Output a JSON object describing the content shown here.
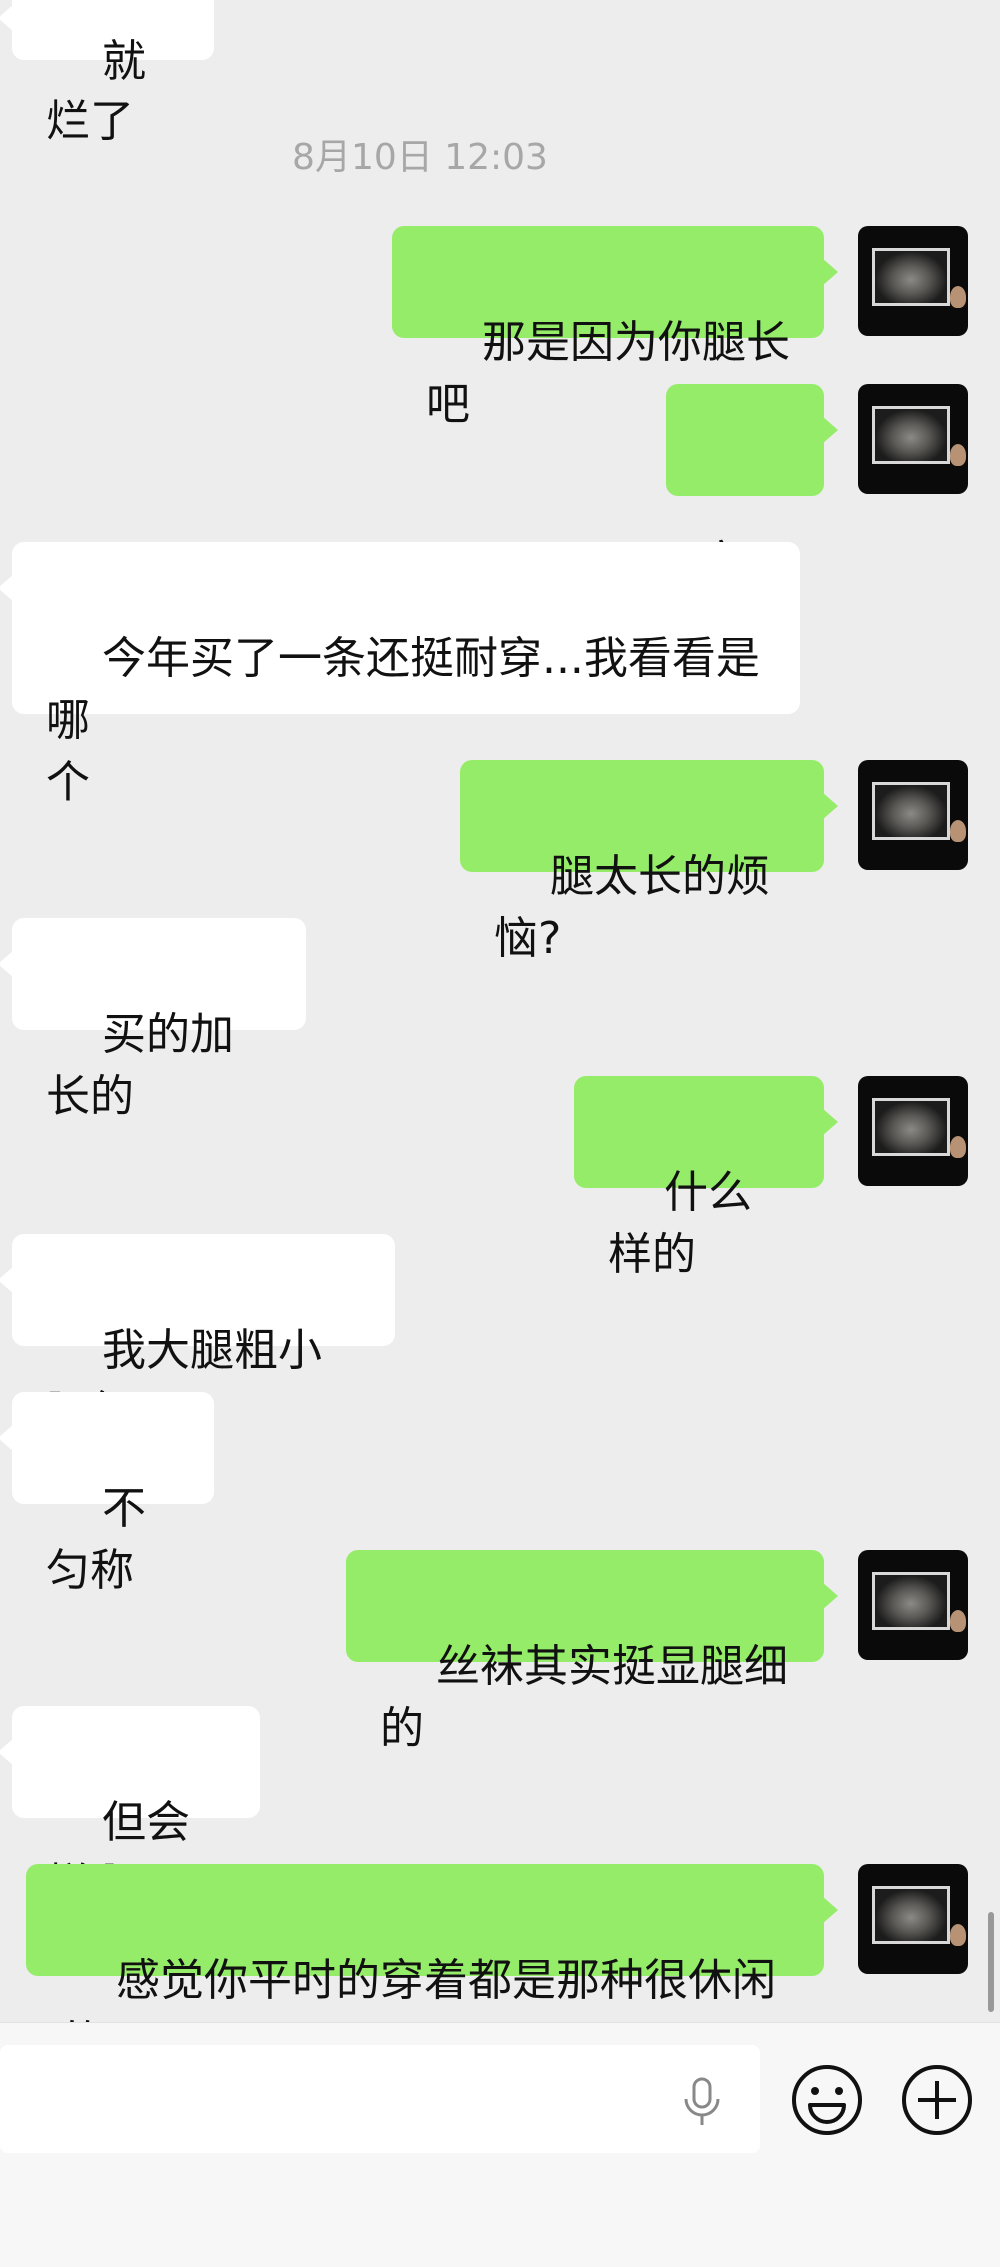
{
  "top_partial": {
    "text": "就烂了"
  },
  "timestamp": "8月10日 12:03",
  "messages": [
    {
      "side": "out",
      "text": "那是因为你腿长吧"
    },
    {
      "side": "out",
      "text": "宝贝"
    },
    {
      "side": "in",
      "text": "今年买了一条还挺耐穿...我看看是哪\n个"
    },
    {
      "side": "out",
      "text": "腿太长的烦恼?"
    },
    {
      "side": "in",
      "text": "买的加长的"
    },
    {
      "side": "out",
      "text": "什么样的"
    },
    {
      "side": "in",
      "text": "我大腿粗小腿细"
    },
    {
      "side": "in",
      "text": "不匀称"
    },
    {
      "side": "out",
      "text": "丝袜其实挺显腿细的"
    },
    {
      "side": "in",
      "text": "但会烂啊"
    },
    {
      "side": "out",
      "text": "感觉你平时的穿着都是那种很休闲的"
    }
  ],
  "input_bar": {
    "field_value": "",
    "icons": [
      "microphone-icon",
      "emoji-icon",
      "plus-icon"
    ]
  },
  "colors": {
    "background": "#ededed",
    "outgoing_bubble": "#95ec69",
    "incoming_bubble": "#ffffff",
    "timestamp_text": "#a7a7a7"
  }
}
